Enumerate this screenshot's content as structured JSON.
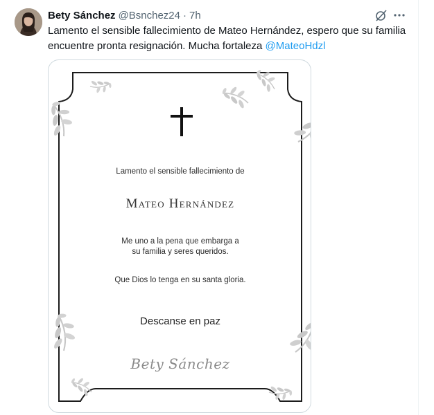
{
  "tweet": {
    "author_name": "Bety Sánchez",
    "handle": "@Bsnchez24",
    "separator": "·",
    "timestamp": "7h",
    "text": "Lamento el sensible fallecimiento de Mateo Hernández, espero que su familia encuentre pronta resignación. Mucha fortaleza ",
    "mention": "@MateoHdzl",
    "icons": [
      "grok-icon",
      "more-icon"
    ]
  },
  "card": {
    "intro": "Lamento el sensible fallecimiento de",
    "deceased_name": "Mateo Hernández",
    "condolence_line1": "Me uno a la pena que embarga a",
    "condolence_line2": "su familia y seres queridos.",
    "prayer": "Que Dios lo tenga en su santa gloria.",
    "rest": "Descanse en paz",
    "signature": "Bety Sánchez"
  },
  "colors": {
    "text": "#0f1419",
    "secondary": "#536471",
    "link": "#1d9bf0",
    "border": "#cfd9de",
    "leaf": "#c8c8c8"
  }
}
